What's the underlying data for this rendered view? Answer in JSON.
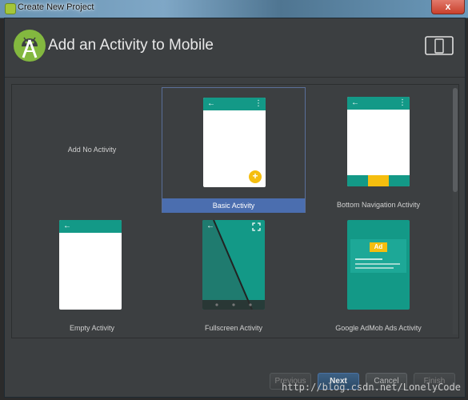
{
  "titlebar": {
    "title": "Create New Project",
    "close_glyph": "x"
  },
  "header": {
    "title": "Add an Activity to Mobile"
  },
  "tiles": [
    {
      "label": "Add No Activity"
    },
    {
      "label": "Basic Activity"
    },
    {
      "label": "Bottom Navigation Activity"
    },
    {
      "label": "Empty Activity"
    },
    {
      "label": "Fullscreen Activity"
    },
    {
      "label": "Google AdMob Ads Activity",
      "ad_badge": "Ad"
    }
  ],
  "phone_glyphs": {
    "back_arrow": "←",
    "overflow": "⋮",
    "fab_plus": "+"
  },
  "buttons": {
    "previous": "Previous",
    "next": "Next",
    "cancel": "Cancel",
    "finish": "Finish"
  },
  "watermark": "http://blog.csdn.net/LonelyCode",
  "icons": {
    "title_app": "android-studio-icon",
    "logo": "android-studio-logo-icon",
    "device": "phone-tablet-icon"
  },
  "colors": {
    "background": "#3c3f41",
    "accent_teal": "#139987",
    "fab_yellow": "#f5be0f",
    "selection_blue": "#4b6eaf"
  }
}
